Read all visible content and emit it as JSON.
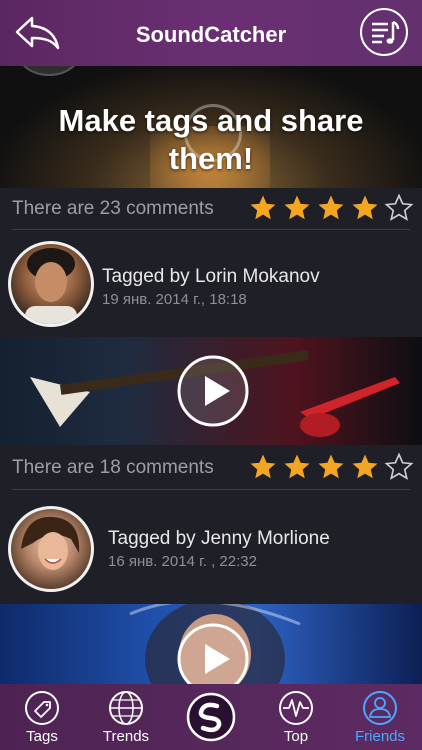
{
  "header": {
    "title": "SoundCatcher",
    "back_icon": "back-arrow-icon",
    "playlist_icon": "playlist-icon"
  },
  "banner": {
    "text": "Make tags and share them!"
  },
  "posts": [
    {
      "comments": "There are 23 comments",
      "rating": 4,
      "rating_max": 5,
      "tagger": "Tagged by Lorin Mokanov",
      "date": "19 янв. 2014 г., 18:18"
    },
    {
      "comments": "There are 18 comments",
      "rating": 4,
      "rating_max": 5,
      "tagger": "Tagged by Jenny Morlione",
      "date": "16 янв. 2014 г. , 22:32"
    }
  ],
  "tabs": [
    {
      "label": "Tags",
      "icon": "tag-icon",
      "active": false
    },
    {
      "label": "Trends",
      "icon": "globe-icon",
      "active": false
    },
    {
      "label": "",
      "icon": "soundcatcher-logo-icon",
      "active": false
    },
    {
      "label": "Top",
      "icon": "waveform-icon",
      "active": false
    },
    {
      "label": "Friends",
      "icon": "person-icon",
      "active": true
    }
  ],
  "colors": {
    "header": "#63306e",
    "tabbar": "#5d2b63",
    "star": "#f4a622",
    "active_tab": "#4aa8ff",
    "background": "#1f2027"
  }
}
